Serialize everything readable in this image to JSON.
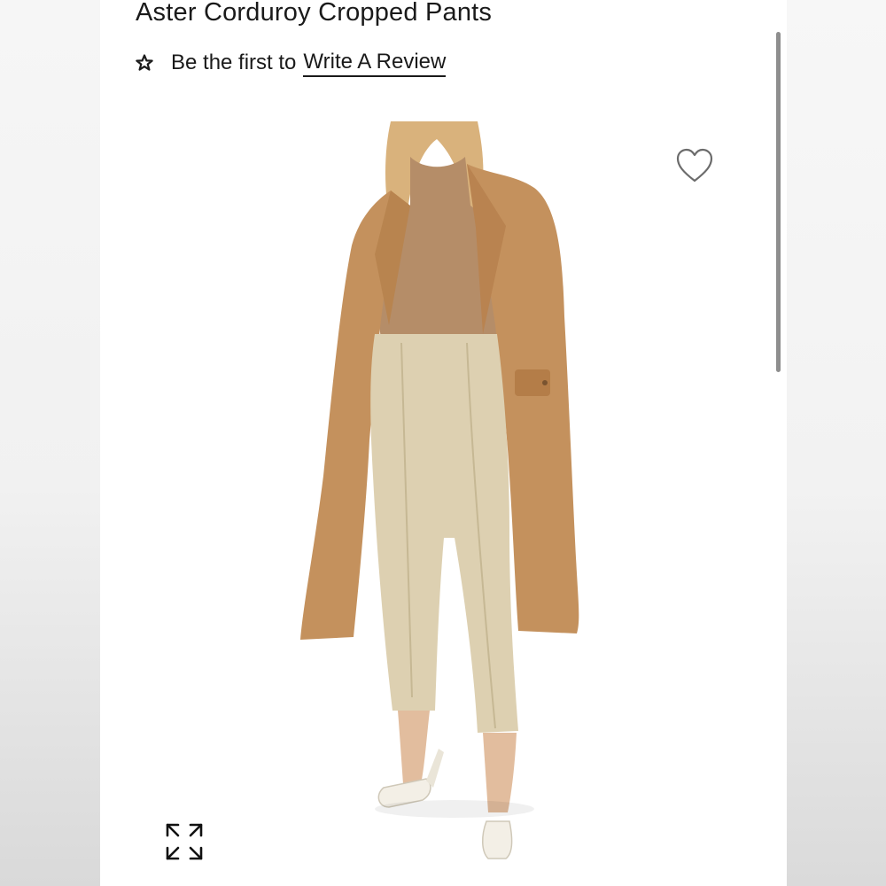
{
  "product": {
    "title": "Aster Corduroy Cropped Pants"
  },
  "review": {
    "prefix": "Be the first to",
    "link_label": "Write A Review",
    "icon": "star-icon"
  },
  "gallery": {
    "favorite_icon": "heart-icon",
    "expand_icon": "expand-icon"
  },
  "colors": {
    "coat": "#c4915d",
    "sweater": "#b58d68",
    "pants": "#ddd0b1",
    "hair": "#d9b27c"
  }
}
